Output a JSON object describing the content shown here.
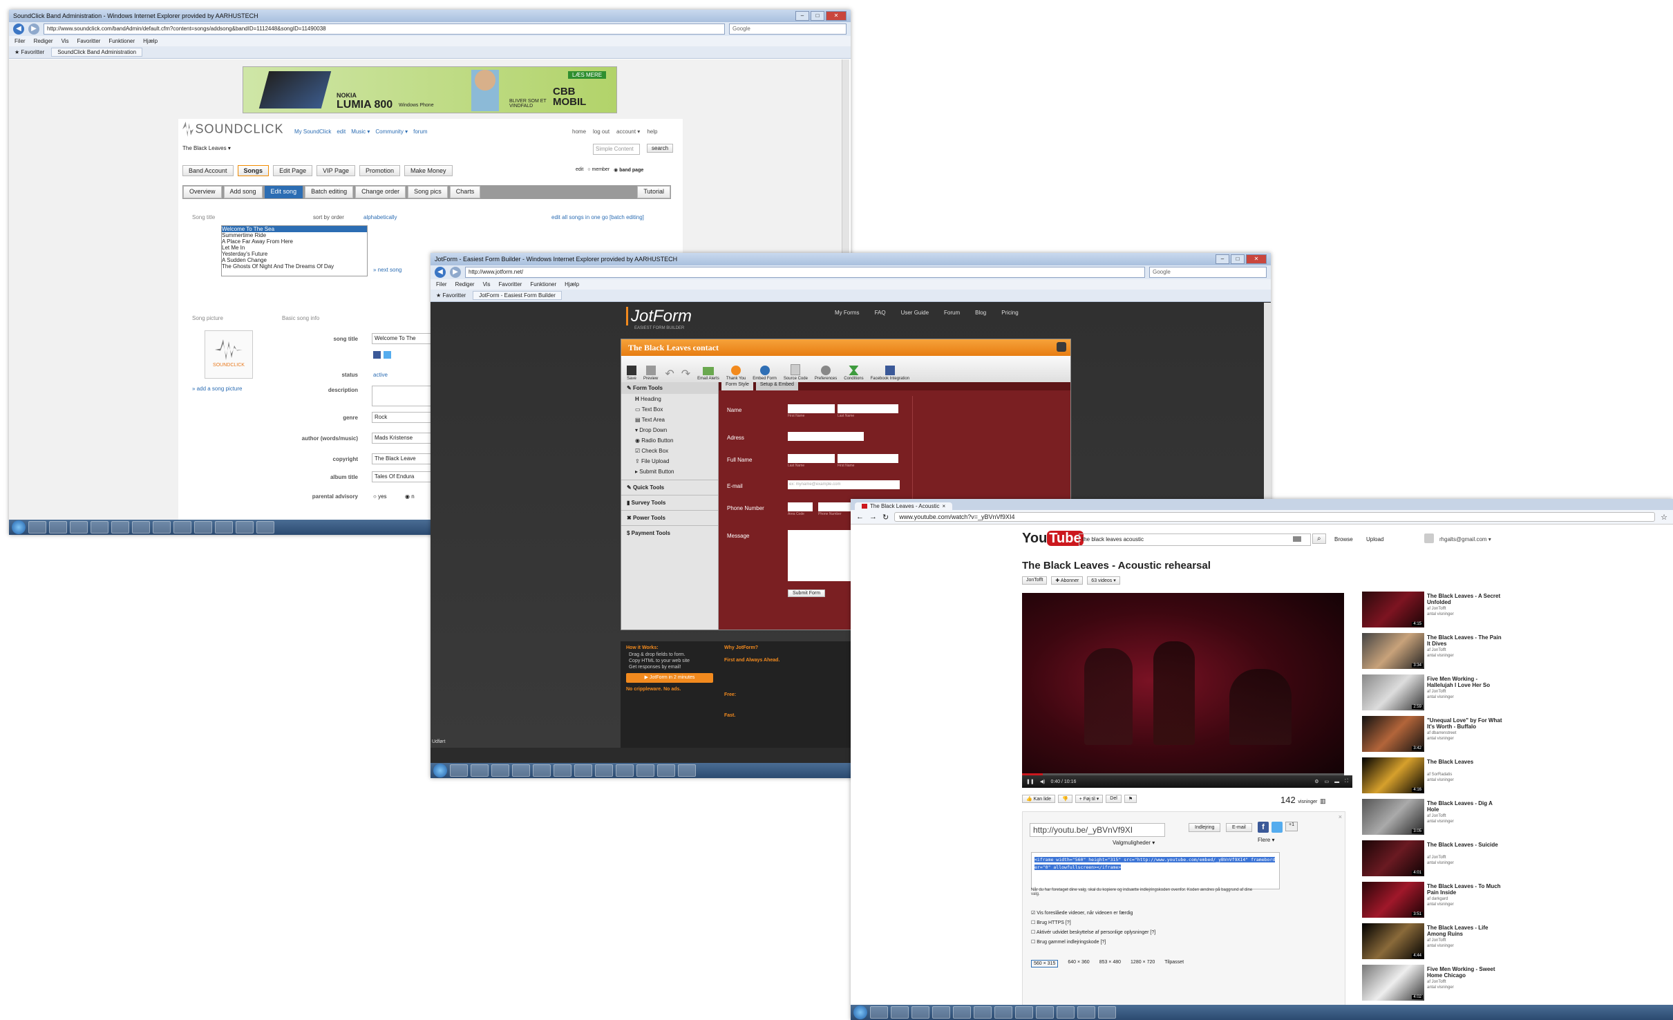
{
  "soundclick": {
    "window_title": "SoundClick Band Administration - Windows Internet Explorer provided by AARHUSTECH",
    "url": "http://www.soundclick.com/bandAdmin/default.cfm?content=songs/addsong&bandID=1112448&songID=11490038",
    "search_placeholder": "Google",
    "menu": [
      "Filer",
      "Rediger",
      "Vis",
      "Favoritter",
      "Funktioner",
      "Hjælp"
    ],
    "favorites_label": "Favoritter",
    "tab_label": "SoundClick Band Administration",
    "ad": {
      "brand": "NOKIA",
      "product": "LUMIA 800",
      "windows_phone": "Windows Phone",
      "cta": "LÆS MERE",
      "tagline": "BLIVER SOM ET VINDFALD",
      "carrier": "CBB MOBIL"
    },
    "logo": "SOUNDCLICK",
    "logo_sub": "THE ARTIST MUSIC COMMUNITY",
    "nav": [
      "My SoundClick",
      "edit",
      "Music ▾",
      "Community ▾",
      "forum"
    ],
    "top_links": [
      "home",
      "log out",
      "account ▾",
      "help"
    ],
    "band_select": "The Black Leaves ▾",
    "search_input": "Simple Content",
    "search_button": "search",
    "main_tabs": [
      "Band Account",
      "Songs",
      "Edit Page",
      "VIP Page",
      "Promotion",
      "Make Money"
    ],
    "member_toggle": [
      "edit",
      "member",
      "band page"
    ],
    "sub_tabs": [
      "Overview",
      "Add song",
      "Edit song",
      "Batch editing",
      "Change order",
      "Song pics",
      "Charts"
    ],
    "tutorial": "Tutorial",
    "song_title_label": "Song title",
    "sort_label": "sort by order",
    "alpha_label": "alphabetically",
    "edit_all_link": "edit all songs in one go [batch editing]",
    "songs": [
      "Welcome To The Sea",
      "Summertime Ride",
      "A Place Far Away From Here",
      "Let Me In",
      "Yesterday's Future",
      "A Sudden Change",
      "The Ghosts Of Night And The Dreams Of Day"
    ],
    "next_song": "» next song",
    "song_picture_label": "Song picture",
    "basic_info_label": "Basic song info",
    "pic_logo": "SOUNDCLICK",
    "add_picture": "» add a song picture",
    "fields": [
      {
        "label": "song title",
        "value": "Welcome To The"
      },
      {
        "label": "status",
        "value": "active"
      },
      {
        "label": "description",
        "value": ""
      },
      {
        "label": "genre",
        "value": "Rock"
      },
      {
        "label": "author (words/music)",
        "value": "Mads Kristense"
      },
      {
        "label": "copyright",
        "value": "The Black Leave"
      },
      {
        "label": "album title",
        "value": "Tales Of Endura"
      },
      {
        "label": "parental advisory",
        "value": "yes"
      }
    ],
    "parental_no": "n"
  },
  "jotform": {
    "window_title": "JotForm - Easiest Form Builder - Windows Internet Explorer provided by AARHUSTECH",
    "url": "http://www.jotform.net/",
    "search_placeholder": "Google",
    "menu": [
      "Filer",
      "Rediger",
      "Vis",
      "Favoritter",
      "Funktioner",
      "Hjælp"
    ],
    "favorites_label": "Favoritter",
    "tab_label": "JotForm - Easiest Form Builder",
    "logo": "JotForm",
    "logo_sub": "EASIEST FORM BUILDER",
    "nav": [
      "My Forms",
      "FAQ",
      "User Guide",
      "Forum",
      "Blog",
      "Pricing"
    ],
    "form_title": "The Black Leaves contact",
    "toolbar": [
      "Save",
      "Preview",
      "",
      "",
      "Email Alerts",
      "Thank You",
      "Embed Form",
      "Source Code",
      "Preferences",
      "Conditions",
      "Facebook Integration"
    ],
    "tools_header": "Form Tools",
    "tools": [
      "Heading",
      "Text Box",
      "Text Area",
      "Drop Down",
      "Radio Button",
      "Check Box",
      "File Upload",
      "Submit Button"
    ],
    "tool_groups": [
      "Quick Tools",
      "Survey Tools",
      "Power Tools",
      "Payment Tools"
    ],
    "canvas_tabs": [
      "Form Style",
      "Setup & Embed"
    ],
    "form_fields": [
      {
        "label": "Name",
        "sub": [
          "First Name",
          "Last Name"
        ]
      },
      {
        "label": "Adress",
        "sub": []
      },
      {
        "label": "Full Name",
        "sub": [
          "Last Name",
          "First Name"
        ]
      },
      {
        "label": "E-mail",
        "sub": [
          "ex: myname@example.com"
        ]
      },
      {
        "label": "Phone Number",
        "sub": [
          "Area Code",
          "Phone Number"
        ]
      },
      {
        "label": "Message",
        "sub": []
      }
    ],
    "submit": "Submit Form",
    "footer_left_title": "How it Works:",
    "footer_left_items": [
      "Drag & drop fields to form.",
      "Copy HTML to your web site",
      "Get responses by email!"
    ],
    "footer_button": "JotForm in 2 minutes",
    "footer_no_ads": "No crippleware. No ads.",
    "footer_right_title": "Why JotForm?",
    "footer_first": "First and Always Ahead.",
    "footer_free": "Free:",
    "footer_fast": "Fast.",
    "status": "Udført"
  },
  "youtube": {
    "tab_title": "The Black Leaves - Acoustic",
    "url": "www.youtube.com/watch?v=_yBVnVf9XI4",
    "search_value": "the black leaves acoustic",
    "browse": "Browse",
    "upload": "Upload",
    "account": "rhgalts@gmail.com ▾",
    "video_title": "The Black Leaves - Acoustic rehearsal",
    "channel": "JonTofft",
    "subscribe": "Abonner",
    "videos_count": "63 videos ▾",
    "player_time": "0:40 / 10:16",
    "actions": [
      "Kan lide",
      "",
      "+ Føj til ▾",
      "Del",
      ""
    ],
    "views": "142",
    "views_label": "visninger",
    "share_url": "http://youtu.be/_yBVnVf9XI",
    "share_more": "Valgmuligheder ▾",
    "share_embed": "Indlejring",
    "share_email": "E-mail",
    "share_more2": "Flere ▾",
    "embed_code": "<iframe width=\"560\" height=\"315\" src=\"http://www.youtube.com/embed/_yBVnVf9XI4\" frameborder=\"0\" allowfullscreen></iframe>",
    "embed_note": "Når du har foretaget dine valg, skal du kopiere og indsætte indlejringskoden ovenfor. Koden ændres på baggrund af dine valg.",
    "options": [
      "Vis foreslåede videoer, når videoen er færdig",
      "Brug HTTPS [?]",
      "Aktivér udvidet beskyttelse af personlige oplysninger [?]",
      "Brug gammel indlejringskode [?]"
    ],
    "sizes": [
      "560 × 315",
      "640 × 360",
      "853 × 480",
      "1280 × 720",
      "Tilpasset"
    ],
    "related": [
      {
        "title": "The Black Leaves - A Secret Unfolded",
        "by": "af JonTofft",
        "views": "antal visninger",
        "dur": "4:15"
      },
      {
        "title": "The Black Leaves - The Pain It Dives",
        "by": "af JonTofft",
        "views": "antal visninger",
        "dur": "3:34"
      },
      {
        "title": "Five Men Working - Hallelujah I Love Her So",
        "by": "af JonTofft",
        "views": "antal visninger",
        "dur": "2:59"
      },
      {
        "title": "\"Unequal Love\" by For What It's Worth - Buffalo",
        "by": "af dbarrenstreet",
        "views": "antal visninger",
        "dur": "3:42"
      },
      {
        "title": "The Black Leaves",
        "by": "af SorRadatis",
        "views": "antal visninger",
        "dur": "4:16"
      },
      {
        "title": "The Black Leaves - Dig A Hole",
        "by": "af JonTofft",
        "views": "antal visninger",
        "dur": "3:05"
      },
      {
        "title": "The Black Leaves - Suicide",
        "by": "af JonTofft",
        "views": "antal visninger",
        "dur": "4:01"
      },
      {
        "title": "The Black Leaves - To Much Pain Inside",
        "by": "af darkgard",
        "views": "antal visninger",
        "dur": "3:51"
      },
      {
        "title": "The Black Leaves - Life Among Ruins",
        "by": "af JonTofft",
        "views": "antal visninger",
        "dur": "4:44"
      },
      {
        "title": "Five Men Working - Sweet Home Chicago",
        "by": "af JonTofft",
        "views": "antal visninger",
        "dur": "4:02"
      }
    ]
  },
  "colors": {
    "sc_blue": "#2c6db3",
    "jot_orange": "#f28a1e",
    "jot_maroon": "#7a1f22",
    "yt_red": "#cc181e"
  }
}
